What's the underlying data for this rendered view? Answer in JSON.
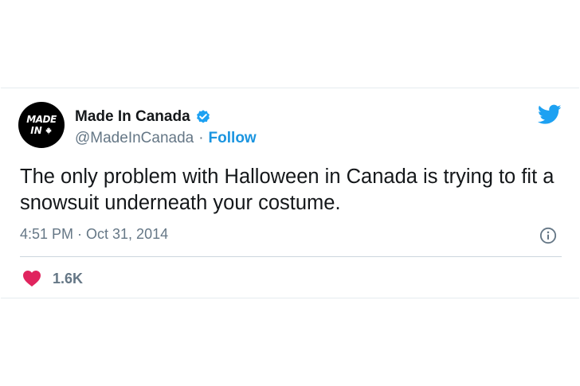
{
  "tweet": {
    "avatar": {
      "line1": "MADE",
      "line2": "IN"
    },
    "display_name": "Made In Canada",
    "handle": "@MadeInCanada",
    "separator": "·",
    "follow_label": "Follow",
    "text": "The only problem with Halloween in Canada is trying to fit a snowsuit underneath your costume.",
    "timestamp": "4:51 PM · Oct 31, 2014",
    "like_count": "1.6K"
  },
  "icons": {
    "brand": "twitter-bird-icon",
    "verified": "verified-badge-icon",
    "info": "info-icon",
    "like": "heart-icon",
    "avatar_glyph": "maple-leaf-icon"
  },
  "colors": {
    "twitter_blue": "#1da1f2",
    "link_blue": "#1b95e0",
    "heart_pink": "#e0245e",
    "text_primary": "#14171a",
    "text_secondary": "#657786"
  }
}
